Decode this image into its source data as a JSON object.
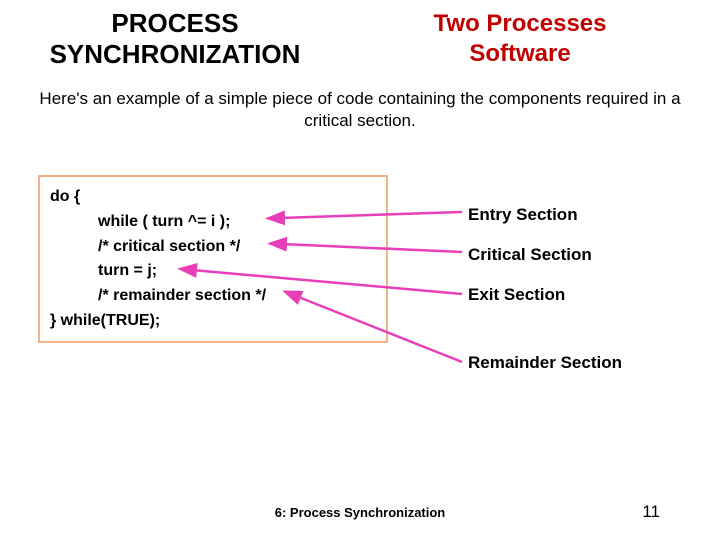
{
  "header": {
    "title_left_l1": "PROCESS",
    "title_left_l2": "SYNCHRONIZATION",
    "title_right_l1": "Two Processes",
    "title_right_l2": "Software"
  },
  "intro": "Here's an example of a simple piece of code containing the components required in a critical section.",
  "code": {
    "l1": "do {",
    "l2": "while  ( turn  ^=  i );",
    "l3": "/* critical section  */",
    "l4": "turn  =  j;",
    "l5": "/* remainder section */",
    "l6": "} while(TRUE);"
  },
  "labels": {
    "entry": "Entry Section",
    "critical": "Critical Section",
    "exit": "Exit Section",
    "remainder": "Remainder Section"
  },
  "footer": {
    "text": "6: Process Synchronization",
    "page": "11"
  },
  "colors": {
    "accent_red": "#c00000",
    "arrow_pink": "#e83fb8",
    "box_border": "#f4b183"
  }
}
